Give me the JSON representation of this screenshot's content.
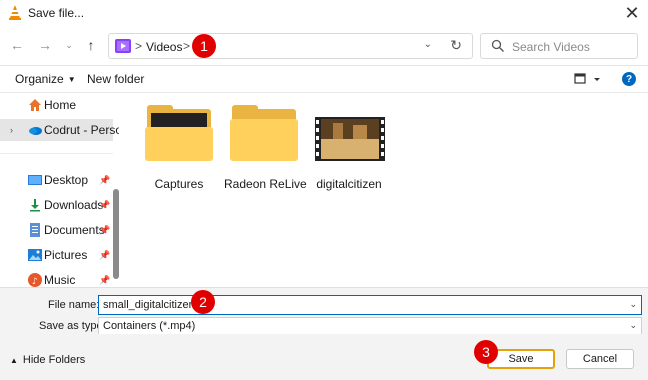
{
  "window": {
    "title": "Save file..."
  },
  "address": {
    "crumb": "Videos",
    "separator": ">"
  },
  "search": {
    "placeholder": "Search Videos"
  },
  "toolbar": {
    "organize": "Organize",
    "new_folder": "New folder",
    "help": "?"
  },
  "callouts": {
    "one": "1",
    "two": "2",
    "three": "3"
  },
  "sidebar": {
    "items": [
      {
        "label": "Home",
        "icon": "home-icon"
      },
      {
        "label": "Codrut - Person",
        "icon": "onedrive-cloud-icon"
      },
      {
        "label": "Desktop",
        "icon": "desktop-icon"
      },
      {
        "label": "Downloads",
        "icon": "downloads-icon"
      },
      {
        "label": "Documents",
        "icon": "documents-icon"
      },
      {
        "label": "Pictures",
        "icon": "pictures-icon"
      },
      {
        "label": "Music",
        "icon": "music-icon"
      }
    ]
  },
  "files": [
    {
      "name": "Captures",
      "type": "folder"
    },
    {
      "name": "Radeon ReLive",
      "type": "folder"
    },
    {
      "name": "digitalcitizen",
      "type": "video"
    }
  ],
  "form": {
    "file_name_label": "File name:",
    "file_name_value": "small_digitalcitizen",
    "save_type_label": "Save as type:",
    "save_type_value": "Containers (*.mp4)"
  },
  "footer": {
    "hide_folders": "Hide Folders",
    "save": "Save",
    "cancel": "Cancel"
  },
  "colors": {
    "accent": "#0067c0",
    "callout": "#e00000",
    "folder": "#ffd15c",
    "save_border": "#e4a10b"
  }
}
